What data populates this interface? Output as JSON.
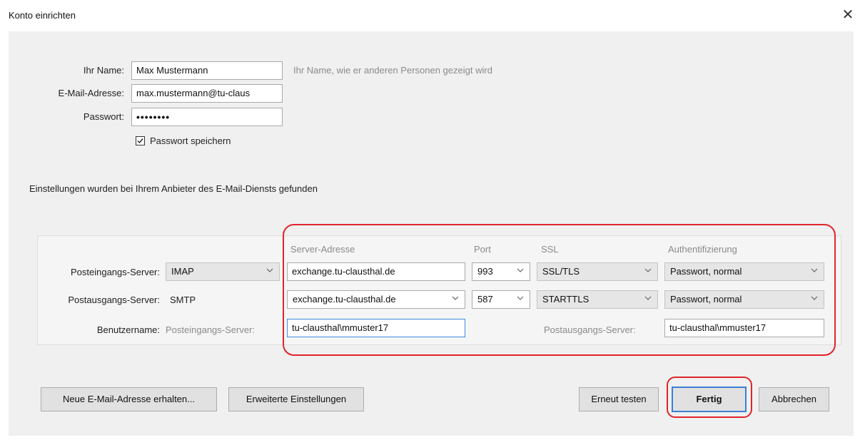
{
  "dialog": {
    "title": "Konto einrichten",
    "close_symbol": "✕"
  },
  "account": {
    "name_label": "Ihr Name:",
    "name_value": "Max Mustermann",
    "name_hint": "Ihr Name, wie er anderen Personen gezeigt wird",
    "email_label": "E-Mail-Adresse:",
    "email_value": "max.mustermann@tu-claus",
    "password_label": "Passwort:",
    "password_value": "••••••••",
    "save_password_label": "Passwort speichern",
    "save_password_checked": true
  },
  "status_message": "Einstellungen wurden bei Ihrem Anbieter des E-Mail-Diensts gefunden",
  "server_table": {
    "columns": {
      "address": "Server-Adresse",
      "port": "Port",
      "ssl": "SSL",
      "auth": "Authentifizierung"
    },
    "incoming": {
      "label": "Posteingangs-Server:",
      "protocol": "IMAP",
      "address": "exchange.tu-clausthal.de",
      "port": "993",
      "ssl": "SSL/TLS",
      "auth": "Passwort, normal"
    },
    "outgoing": {
      "label": "Postausgangs-Server:",
      "protocol": "SMTP",
      "address": "exchange.tu-clausthal.de",
      "port": "587",
      "ssl": "STARTTLS",
      "auth": "Passwort, normal"
    },
    "username": {
      "label": "Benutzername:",
      "incoming_label": "Posteingangs-Server:",
      "incoming_value": "tu-clausthal\\mmuster17",
      "outgoing_label": "Postausgangs-Server:",
      "outgoing_value": "tu-clausthal\\mmuster17"
    }
  },
  "buttons": {
    "new_email": "Neue E-Mail-Adresse erhalten...",
    "advanced": "Erweiterte Einstellungen",
    "retest": "Erneut testen",
    "done": "Fertig",
    "cancel": "Abbrechen"
  },
  "colors": {
    "highlight": "#e0242b",
    "focus": "#3c7fd0"
  }
}
